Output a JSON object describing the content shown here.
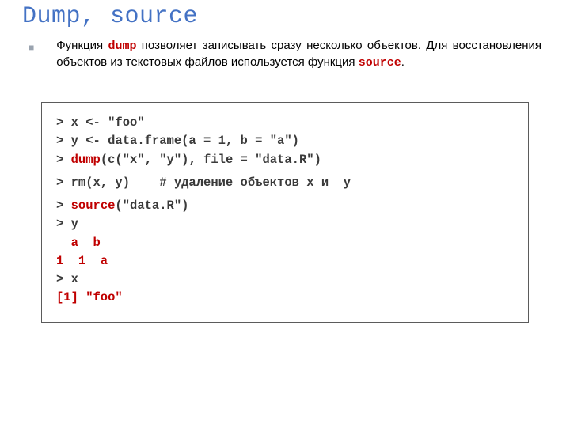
{
  "title": "Dump, source",
  "para": {
    "t1": "Функция ",
    "kw1": "dump",
    "t2": "  позволяет записывать сразу несколько объектов. Для восстановления объектов из текстовых файлов используется функция ",
    "kw2": "source",
    "t3": "."
  },
  "code": {
    "l1a": "> x <- \"foo\"",
    "l2a": "> y <- data.frame(a = 1, b = \"a\")",
    "l3a": "> ",
    "l3b": "dump",
    "l3c": "(c(\"x\", \"y\"), file = \"data.R\")",
    "l4a": "> rm(x, y)    # удаление объектов x и  y",
    "l5a": "> ",
    "l5b": "source",
    "l5c": "(\"data.R\")",
    "l6a": "> y",
    "l7a": "  a  b",
    "l8a": "1  1  a",
    "l9a": "> x",
    "l10a": "[1] \"foo\""
  }
}
